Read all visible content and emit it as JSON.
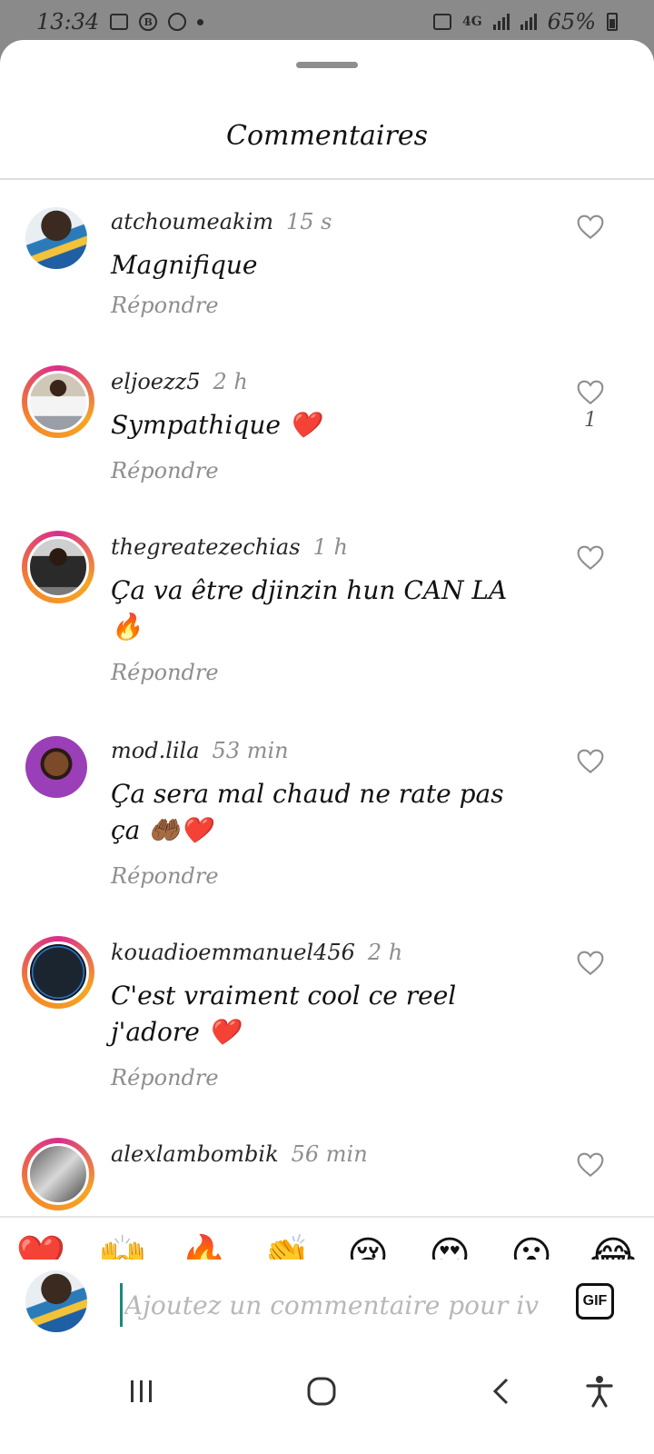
{
  "status_bar": {
    "time": "13:34",
    "network": "4G",
    "battery": "65%"
  },
  "sheet": {
    "title": "Commentaires"
  },
  "comments": [
    {
      "user": "atchoumeakim",
      "time": "15 s",
      "text": "Magnifique",
      "reply": "Répondre",
      "likes": ""
    },
    {
      "user": "eljoezz5",
      "time": "2 h",
      "text": "Sympathique ❤️",
      "reply": "Répondre",
      "likes": "1"
    },
    {
      "user": "thegreatezechias",
      "time": "1 h",
      "text": "Ça va être djinzin hun CAN LA 🔥",
      "reply": "Répondre",
      "likes": ""
    },
    {
      "user": "mod.lila",
      "time": "53 min",
      "text": "Ça sera mal  chaud ne rate pas ça 🤲🏾❤️",
      "reply": "Répondre",
      "likes": ""
    },
    {
      "user": "kouadioemmanuel456",
      "time": "2 h",
      "text": "C'est vraiment cool ce reel j'adore ❤️",
      "reply": "Répondre",
      "likes": ""
    },
    {
      "user": "alexlambombik",
      "time": "56 min",
      "text": "",
      "reply": "",
      "likes": ""
    }
  ],
  "emoji_bar": [
    "❤️",
    "🙌",
    "🔥",
    "👏",
    "😢",
    "😍",
    "😮",
    "😂"
  ],
  "composer": {
    "placeholder": "Ajoutez un commentaire pour iv",
    "gif_label": "GIF"
  },
  "icons": {
    "heart": "heart-outline-icon",
    "recents": "recent-apps-icon",
    "home": "home-icon",
    "back": "back-icon",
    "accessibility": "accessibility-icon"
  },
  "colors": {
    "story_ring_start": "#d92d8e",
    "story_ring_end": "#f5a623",
    "muted_text": "#8e8e8e",
    "cursor": "#1a8a7a"
  }
}
